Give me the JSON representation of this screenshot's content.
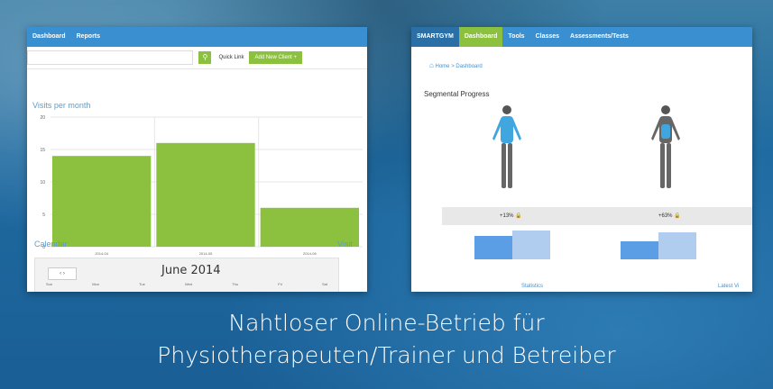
{
  "caption": {
    "line1": "Nahtloser Online-Betrieb für",
    "line2": "Physiotherapeuten/Trainer und Betreiber"
  },
  "left_screenshot": {
    "nav": [
      "Dashboard",
      "Reports"
    ],
    "toolbar": {
      "search_icon": "search-icon",
      "quick_link_label": "Quick Link",
      "add_button_label": "Add New Client +"
    },
    "chart_title": "Visits per month",
    "calendar": {
      "title": "Calendar",
      "month": "June 2014",
      "nav_label": "‹ ›",
      "days": [
        "Sun",
        "Mon",
        "Tue",
        "Wed",
        "Thu",
        "Fri",
        "Sat"
      ]
    },
    "side_label": "Visit"
  },
  "chart_data": {
    "type": "bar",
    "title": "Visits per month",
    "categories": [
      "2014-04",
      "2014-05",
      "2014-06"
    ],
    "values": [
      14,
      16,
      6
    ],
    "ylim": [
      0,
      20
    ],
    "yticks": [
      0,
      5,
      10,
      15,
      20
    ],
    "color": "#8cc13f",
    "grid": true
  },
  "right_screenshot": {
    "nav": {
      "brand": "SMARTGYM",
      "items": [
        "Dashboard",
        "Tools",
        "Classes",
        "Assessments/Tests"
      ],
      "active_index": 0
    },
    "breadcrumb": "Home > Dashboard",
    "section_title": "Segmental Progress",
    "stats": [
      "+13%",
      "+63%"
    ],
    "bottom_labels": [
      "Statistics",
      "Latest Vi"
    ]
  },
  "colors": {
    "accent_green": "#8cc13f",
    "nav_blue": "#3a8fd0",
    "body_highlight": "#3fa6e0"
  }
}
